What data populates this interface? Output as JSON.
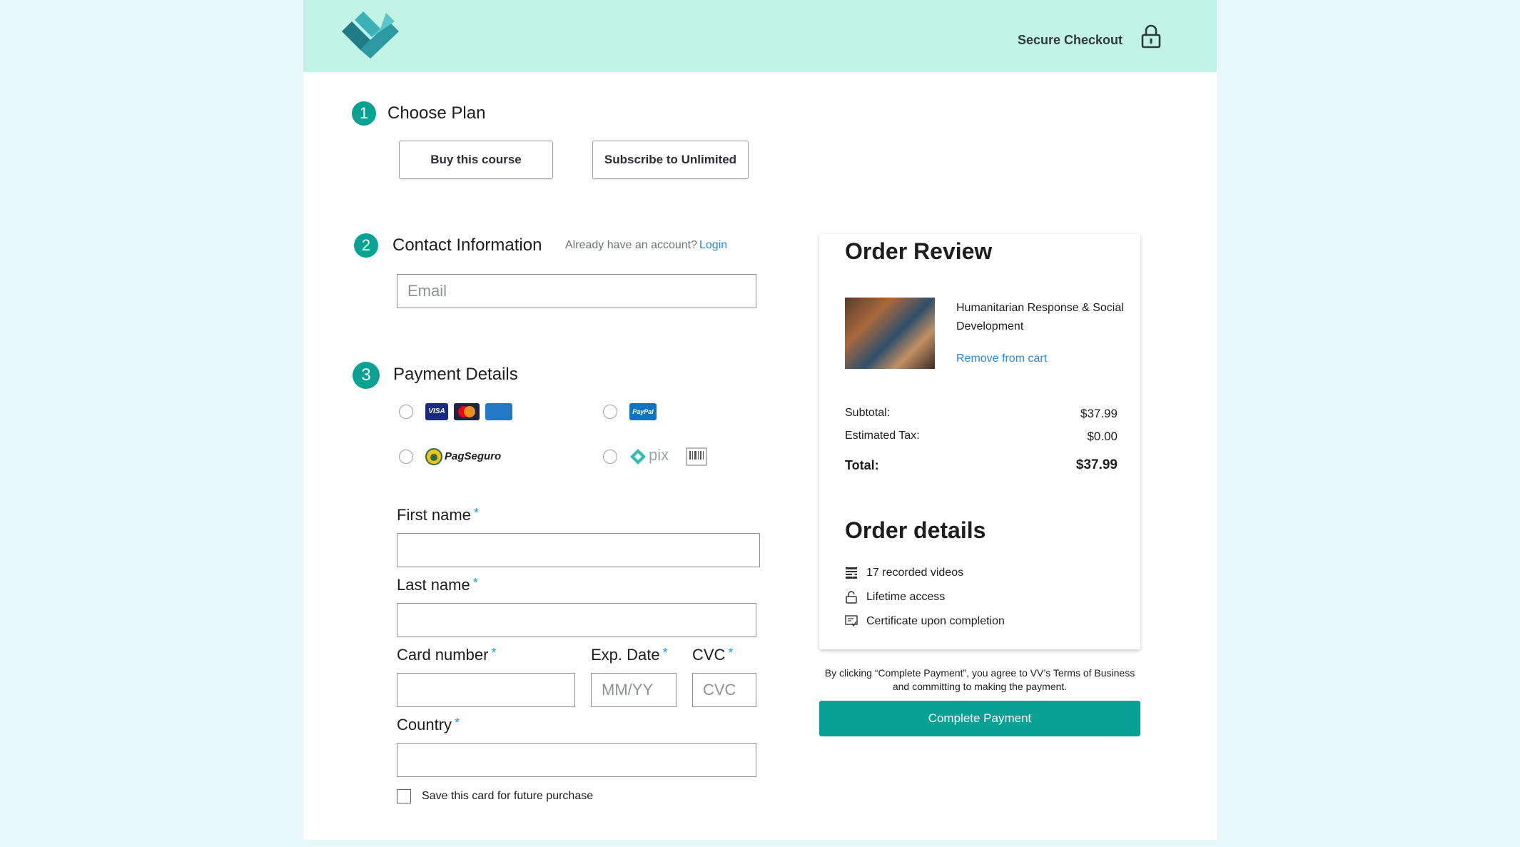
{
  "header": {
    "secure_label": "Secure Checkout"
  },
  "steps": {
    "plan": {
      "number": "1",
      "title": "Choose Plan",
      "buy_label": "Buy this course",
      "subscribe_label": "Subscribe to Unlimited"
    },
    "contact": {
      "number": "2",
      "title": "Contact Information",
      "account_prompt": "Already have an account?",
      "login_label": "Login",
      "email_placeholder": "Email"
    },
    "payment": {
      "number": "3",
      "title": "Payment Details",
      "methods": {
        "cards": "VISA",
        "paypal": "PayPal",
        "pagseguro": "PagSeguro",
        "pix": "pix"
      },
      "first_name_label": "First name",
      "last_name_label": "Last name",
      "card_number_label": "Card number",
      "exp_label": "Exp. Date",
      "exp_placeholder": "MM/YY",
      "cvc_label": "CVC",
      "cvc_placeholder": "CVC",
      "country_label": "Country",
      "required_mark": "*",
      "save_card_label": "Save this card for future purchase"
    }
  },
  "order_review": {
    "title": "Order Review",
    "course_title": "Humanitarian Response & Social Development",
    "remove_label": "Remove from cart",
    "subtotal_label": "Subtotal:",
    "subtotal_value": "$37.99",
    "tax_label": "Estimated Tax:",
    "tax_value": "$0.00",
    "total_label": "Total:",
    "total_value": "$37.99"
  },
  "order_details": {
    "title": "Order details",
    "items": [
      "17 recorded videos",
      "Lifetime access",
      "Certificate upon completion"
    ]
  },
  "checkout": {
    "terms_text": "By clicking “Complete Payment”, you agree to VV’s Terms of Business and committing to making the payment.",
    "pay_label": "Complete Payment"
  },
  "colors": {
    "brand_teal": "#07a294",
    "header_mint": "#c2f3e7",
    "link_blue": "#2d86d6"
  }
}
